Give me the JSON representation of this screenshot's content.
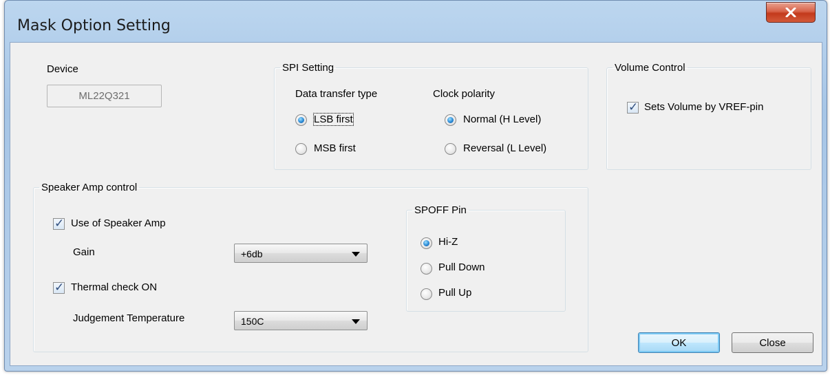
{
  "window": {
    "title": "Mask Option Setting",
    "close_glyph": "X"
  },
  "device": {
    "label": "Device",
    "value": "ML22Q321"
  },
  "spi_setting": {
    "legend": "SPI Setting",
    "data_transfer_type": {
      "label": "Data transfer type",
      "options": [
        "LSB first",
        "MSB first"
      ],
      "selected": "LSB first"
    },
    "clock_polarity": {
      "label": "Clock polarity",
      "options": [
        "Normal (H Level)",
        "Reversal (L Level)"
      ],
      "selected": "Normal (H Level)"
    }
  },
  "volume_control": {
    "legend": "Volume Control",
    "checkbox_label": "Sets Volume by VREF-pin",
    "checked": true
  },
  "speaker_amp": {
    "legend": "Speaker Amp control",
    "use_amp": {
      "label": "Use of Speaker Amp",
      "checked": true
    },
    "gain": {
      "label": "Gain",
      "value": "+6db"
    },
    "thermal": {
      "label": "Thermal check ON",
      "checked": true
    },
    "temperature": {
      "label": "Judgement Temperature",
      "value": "150C"
    },
    "spoff_pin": {
      "legend": "SPOFF Pin",
      "options": [
        "Hi-Z",
        "Pull Down",
        "Pull Up"
      ],
      "selected": "Hi-Z"
    }
  },
  "buttons": {
    "ok": "OK",
    "close": "Close"
  },
  "icons": {
    "close": "close-icon",
    "dropdown": "chevron-down-icon",
    "check": "checkmark-icon"
  },
  "colors": {
    "titlebar": "#a6c5e6",
    "close_button": "#c3391c",
    "dialog_bg": "#f0f0f0",
    "default_button": "#a7d9f5"
  }
}
